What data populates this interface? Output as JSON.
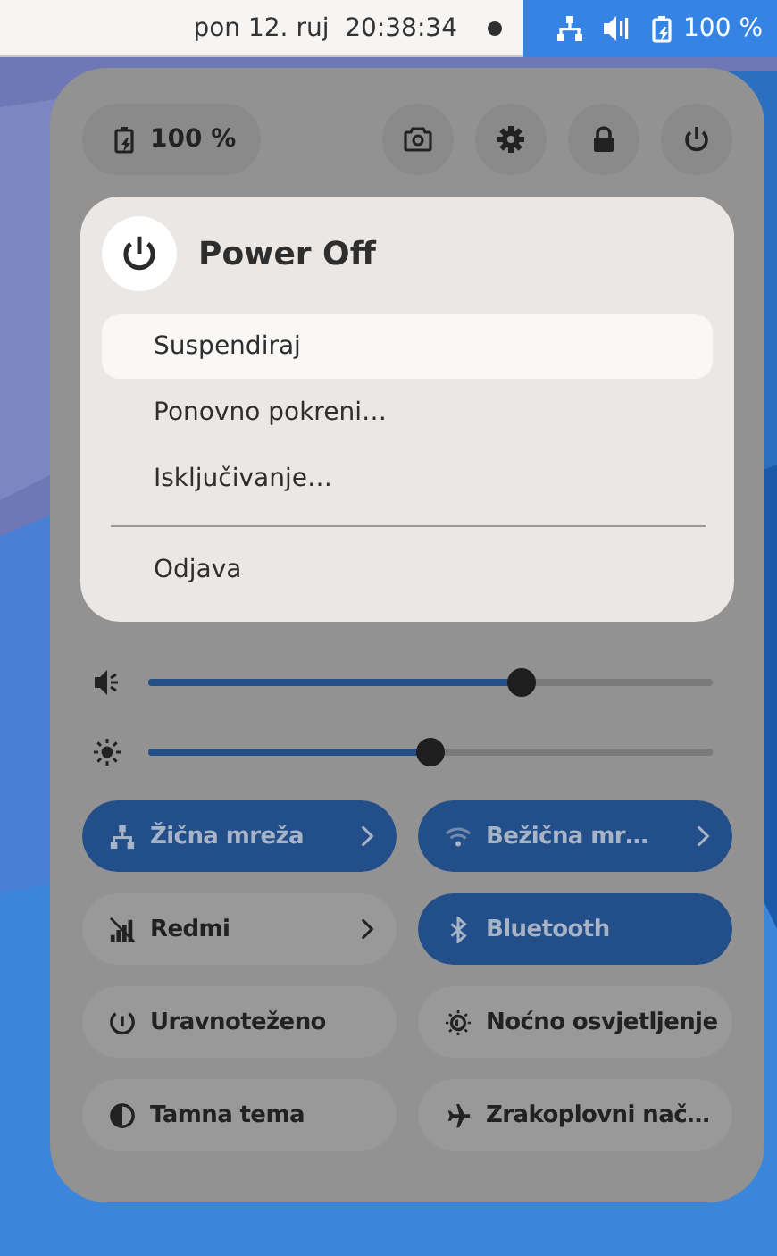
{
  "top_bar": {
    "clock": "pon 12. ruj  20:38:34",
    "status": {
      "battery": "100 %"
    }
  },
  "quick_settings": {
    "battery": "100 %",
    "power_menu": {
      "title": "Power Off",
      "sections": [
        [
          {
            "label": "Suspendiraj",
            "selected": true
          },
          {
            "label": "Ponovno pokreni…",
            "selected": false
          },
          {
            "label": "Isključivanje…",
            "selected": false
          }
        ],
        [
          {
            "label": "Odjava",
            "selected": false
          }
        ]
      ]
    },
    "sliders": [
      {
        "kind": "volume",
        "level": 0.66
      },
      {
        "kind": "brightness",
        "level": 0.5
      }
    ],
    "toggles": [
      {
        "kind": "wired",
        "label": "Žična mreža",
        "on": true,
        "has_menu": true
      },
      {
        "kind": "wifi",
        "label": "Bežična mr…",
        "on": true,
        "has_menu": true
      },
      {
        "kind": "mobile",
        "label": "Redmi",
        "on": false,
        "has_menu": true
      },
      {
        "kind": "bluetooth",
        "label": "Bluetooth",
        "on": true,
        "has_menu": false
      },
      {
        "kind": "power-mode",
        "label": "Uravnoteženo",
        "on": false,
        "has_menu": false
      },
      {
        "kind": "night-light",
        "label": "Noćno osvjetljenje",
        "on": false,
        "has_menu": false
      },
      {
        "kind": "dark-style",
        "label": "Tamna tema",
        "on": false,
        "has_menu": false
      },
      {
        "kind": "airplane",
        "label": "Zrakoplovni nač…",
        "on": false,
        "has_menu": false
      }
    ]
  }
}
